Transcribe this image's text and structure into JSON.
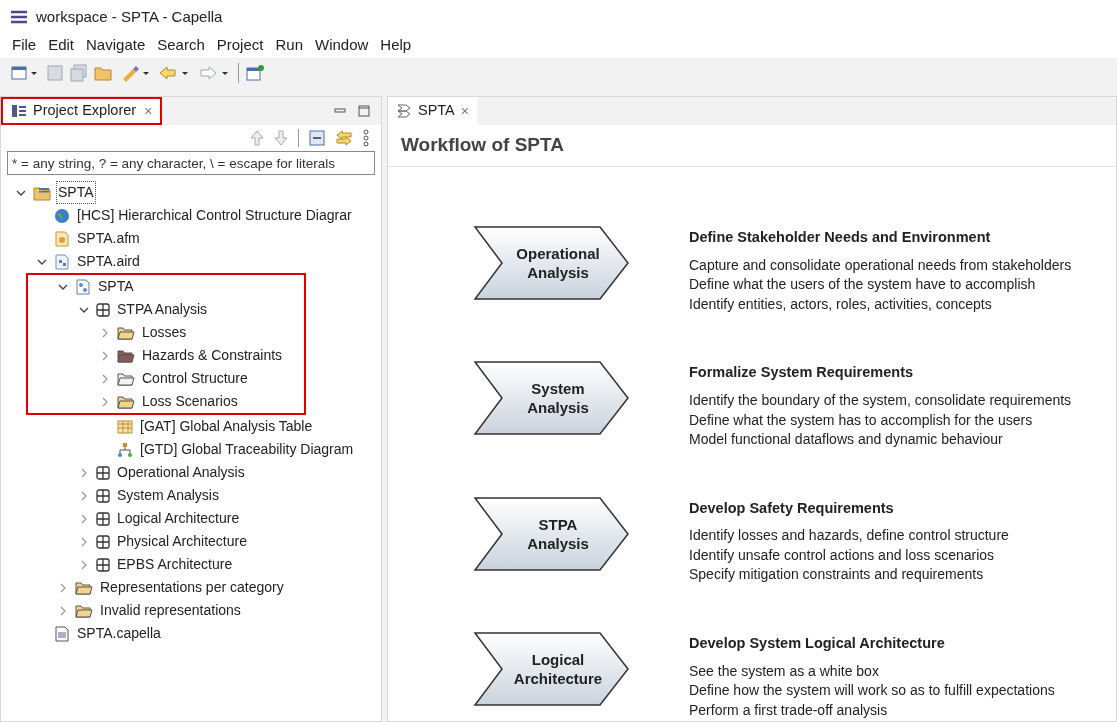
{
  "window": {
    "title": "workspace - SPTA - Capella"
  },
  "menu": [
    "File",
    "Edit",
    "Navigate",
    "Search",
    "Project",
    "Run",
    "Window",
    "Help"
  ],
  "explorer": {
    "tab": {
      "label": "Project Explorer",
      "close": "×",
      "highlighted": true
    },
    "filter": {
      "placeholder": "* = any string, ? = any character, \\ = escape for literals"
    },
    "tree": [
      {
        "label": "SPTA",
        "kind": "project",
        "expanded": true,
        "selected": true,
        "children": [
          {
            "label": "[HCS] Hierarchical Control Structure Diagrar",
            "kind": "globe"
          },
          {
            "label": "SPTA.afm",
            "kind": "afm"
          },
          {
            "label": "SPTA.aird",
            "kind": "aird",
            "expanded": true,
            "children": [
              {
                "label": "SPTA",
                "kind": "model",
                "expanded": true,
                "highlighted": true,
                "children": [
                  {
                    "label": "STPA Analysis",
                    "kind": "package",
                    "expanded": true,
                    "highlighted": true,
                    "children": [
                      {
                        "label": "Losses",
                        "kind": "folder",
                        "expanded": false,
                        "highlighted": true,
                        "color": "#f3d58a"
                      },
                      {
                        "label": "Hazards & Constraints",
                        "kind": "folder",
                        "expanded": false,
                        "highlighted": true,
                        "color": "#8a5a5a"
                      },
                      {
                        "label": "Control Structure",
                        "kind": "folder",
                        "expanded": false,
                        "highlighted": true,
                        "color": "#f4f4f4"
                      },
                      {
                        "label": "Loss Scenarios",
                        "kind": "folder",
                        "expanded": false,
                        "highlighted": true,
                        "color": "#f3d58a"
                      },
                      {
                        "label": "[GAT] Global Analysis Table",
                        "kind": "table"
                      },
                      {
                        "label": "[GTD] Global Traceability Diagram",
                        "kind": "diagram"
                      }
                    ]
                  },
                  {
                    "label": "Operational Analysis",
                    "kind": "package",
                    "expanded": false
                  },
                  {
                    "label": "System Analysis",
                    "kind": "package",
                    "expanded": false
                  },
                  {
                    "label": "Logical Architecture",
                    "kind": "package",
                    "expanded": false
                  },
                  {
                    "label": "Physical Architecture",
                    "kind": "package",
                    "expanded": false
                  },
                  {
                    "label": "EPBS Architecture",
                    "kind": "package",
                    "expanded": false
                  }
                ]
              },
              {
                "label": "Representations per category",
                "kind": "folder",
                "expanded": false,
                "color": "#f3d58a"
              },
              {
                "label": "Invalid representations",
                "kind": "folder",
                "expanded": false,
                "color": "#f3d58a"
              }
            ]
          },
          {
            "label": "SPTA.capella",
            "kind": "file"
          }
        ]
      }
    ]
  },
  "editor": {
    "tab": {
      "label": "SPTA",
      "close": "×"
    },
    "title": "Workflow of SPTA",
    "steps": [
      {
        "label": "Operational Analysis",
        "heading": "Define Stakeholder Needs and Environment",
        "lines": [
          "Capture and consolidate operational needs from stakeholders",
          "Define what the users of the system have to accomplish",
          "Identify entities, actors, roles, activities, concepts"
        ]
      },
      {
        "label": "System Analysis",
        "heading": "Formalize System Requirements",
        "lines": [
          "Identify the boundary of the system, consolidate requirements",
          "Define what the system has to accomplish for the users",
          "Model functional dataflows and dynamic behaviour"
        ]
      },
      {
        "label": "STPA Analysis",
        "heading": "Develop Safety Requirements",
        "lines": [
          "Identify losses and hazards, define control structure",
          "Identify unsafe control actions and loss scenarios",
          "Specify mitigation constraints and requirements"
        ]
      },
      {
        "label": "Logical Architecture",
        "heading": "Develop System Logical Architecture",
        "lines": [
          "See the system as a white box",
          "Define how the system will work so as to fulfill expectations",
          "Perform a first trade-off analysis"
        ]
      }
    ]
  }
}
